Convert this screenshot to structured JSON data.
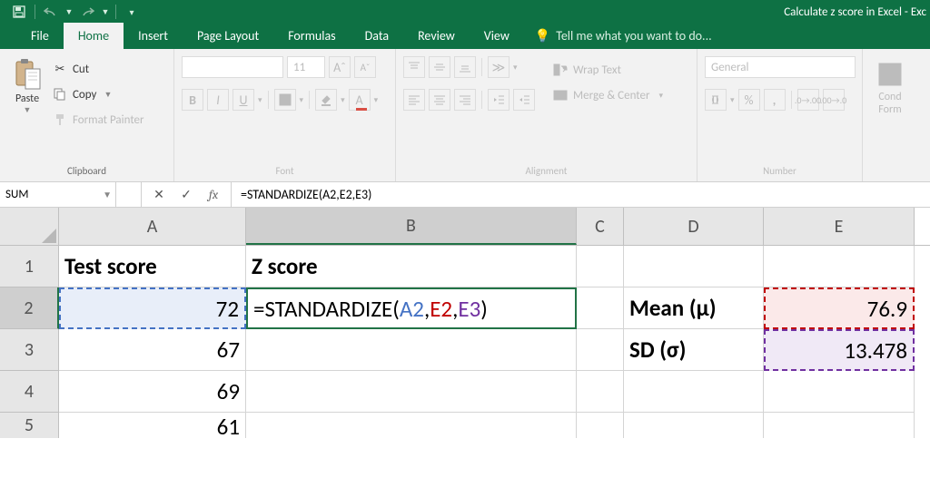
{
  "titlebar": {
    "title": "Calculate z score in Excel - Exc"
  },
  "tabs": {
    "file": "File",
    "home": "Home",
    "insert": "Insert",
    "page_layout": "Page Layout",
    "formulas": "Formulas",
    "data": "Data",
    "review": "Review",
    "view": "View",
    "tell_me": "Tell me what you want to do..."
  },
  "ribbon": {
    "clipboard": {
      "paste": "Paste",
      "cut": "Cut",
      "copy": "Copy",
      "format_painter": "Format Painter",
      "label": "Clipboard"
    },
    "font": {
      "family": "",
      "size": "11",
      "label": "Font"
    },
    "alignment": {
      "wrap": "Wrap Text",
      "merge": "Merge & Center",
      "label": "Alignment"
    },
    "number": {
      "format": "General",
      "label": "Number"
    },
    "cond": {
      "label": "Cond",
      "label2": "Form"
    }
  },
  "formula_bar": {
    "name_box": "SUM",
    "formula": "=STANDARDIZE(A2,E2,E3)"
  },
  "columns": [
    "A",
    "B",
    "C",
    "D",
    "E"
  ],
  "rows": [
    "1",
    "2",
    "3",
    "4",
    "5"
  ],
  "cells": {
    "A1": "Test score",
    "B1": "Z score",
    "A2": "72",
    "B2_prefix": "=STANDARDIZE(",
    "B2_a": "A2",
    "B2_c1": ",",
    "B2_e2": "E2",
    "B2_c2": ",",
    "B2_e3": "E3",
    "B2_suffix": ")",
    "D2": "Mean (μ)",
    "E2": "76.9",
    "A3": "67",
    "D3": "SD (σ)",
    "E3": "13.478",
    "A4": "69",
    "A5": "61"
  }
}
